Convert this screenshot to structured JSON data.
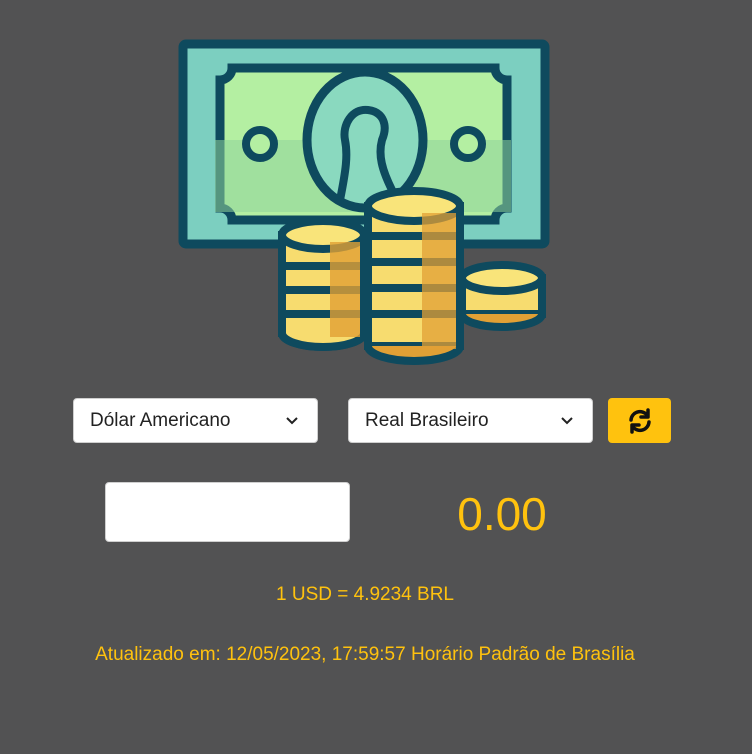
{
  "converter": {
    "from_currency": "Dólar Americano",
    "to_currency": "Real Brasileiro",
    "amount_value": "",
    "result": "0.00",
    "rate_text": "1 USD = 4.9234 BRL",
    "updated_text": "Atualizado em: 12/05/2023, 17:59:57 Horário Padrão de Brasília"
  },
  "icons": {
    "hero": "money-coins-icon",
    "swap": "refresh-icon",
    "dropdown": "chevron-down-icon"
  },
  "colors": {
    "background": "#525253",
    "accent": "#ffc20e",
    "outline": "#0e4a5e"
  }
}
